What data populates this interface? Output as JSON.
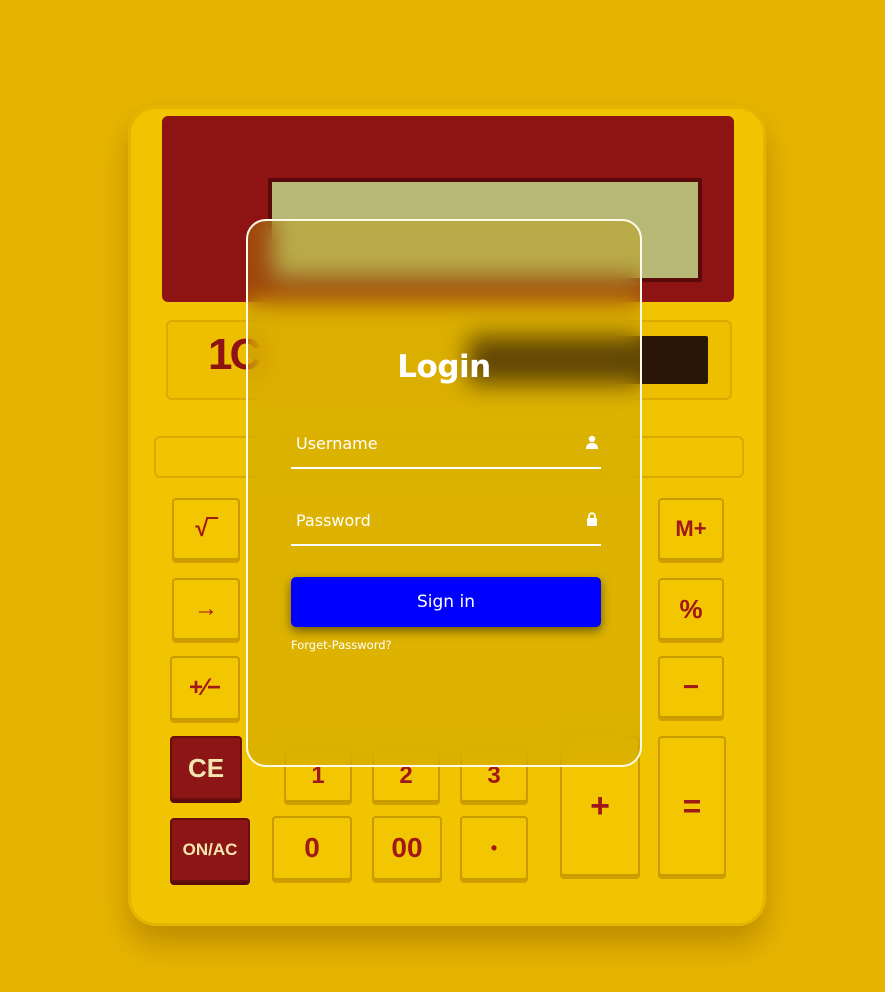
{
  "login": {
    "title": "Login",
    "username": {
      "placeholder": "Username",
      "value": "",
      "icon": "user-icon"
    },
    "password": {
      "placeholder": "Password",
      "value": "",
      "icon": "lock-icon"
    },
    "submit_label": "Sign in",
    "forgot_label": "Forget-Password?"
  },
  "background": {
    "brand_text": "1C",
    "keys": {
      "sqrt": "√‾",
      "arrow": "→",
      "plusminus": "+∕−",
      "ce": "CE",
      "onac": "ON/AC",
      "mplus": "M+",
      "percent": "%",
      "minus": "−",
      "plus": "+",
      "equals": "=",
      "one": "1",
      "two": "2",
      "three": "3",
      "zero": "0",
      "doublezero": "00",
      "dot": "•"
    }
  },
  "colors": {
    "background": "#e6b400",
    "button": "#0000ff",
    "card_border": "#ffffff",
    "calculator_accent": "#8e1414"
  }
}
